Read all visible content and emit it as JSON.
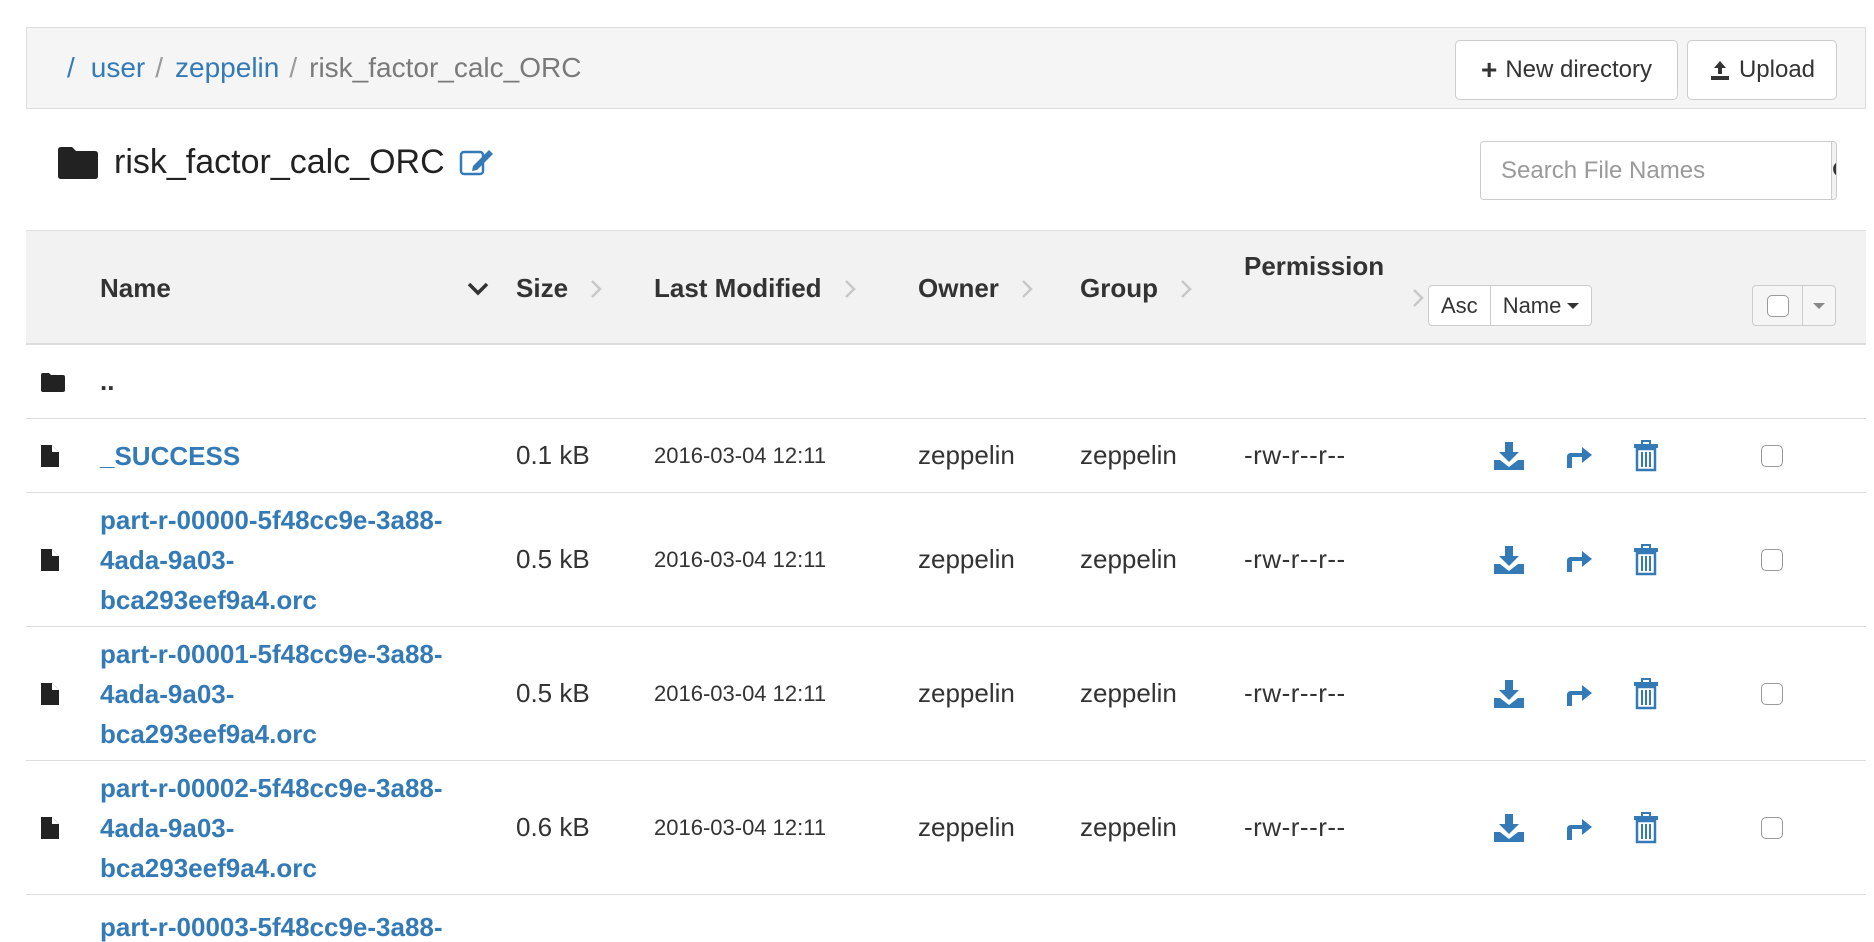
{
  "breadcrumb": {
    "root": "/",
    "separator": "/",
    "items": [
      "user",
      "zeppelin"
    ],
    "current": "risk_factor_calc_ORC"
  },
  "toolbar": {
    "new_directory_label": "New directory",
    "upload_label": "Upload"
  },
  "directory": {
    "title": "risk_factor_calc_ORC"
  },
  "search": {
    "placeholder": "Search File Names",
    "value": ""
  },
  "table": {
    "headers": {
      "name": "Name",
      "size": "Size",
      "last_modified": "Last Modified",
      "owner": "Owner",
      "group": "Group",
      "permission": "Permission"
    },
    "sort": {
      "order_label": "Asc",
      "field_label": "Name"
    },
    "parent_row": {
      "name": ".."
    },
    "rows": [
      {
        "name": "_SUCCESS",
        "name_lines": [
          "_SUCCESS"
        ],
        "size": "0.1 kB",
        "modified": "2016-03-04 12:11",
        "owner": "zeppelin",
        "group": "zeppelin",
        "permission": "-rw-r--r--",
        "checked": false
      },
      {
        "name": "part-r-00000-5f48cc9e-3a88-4ada-9a03-bca293eef9a4.orc",
        "name_lines": [
          "part-r-00000-5f48cc9e-3a88-",
          "4ada-9a03-",
          "bca293eef9a4.orc"
        ],
        "size": "0.5 kB",
        "modified": "2016-03-04 12:11",
        "owner": "zeppelin",
        "group": "zeppelin",
        "permission": "-rw-r--r--",
        "checked": false
      },
      {
        "name": "part-r-00001-5f48cc9e-3a88-4ada-9a03-bca293eef9a4.orc",
        "name_lines": [
          "part-r-00001-5f48cc9e-3a88-",
          "4ada-9a03-",
          "bca293eef9a4.orc"
        ],
        "size": "0.5 kB",
        "modified": "2016-03-04 12:11",
        "owner": "zeppelin",
        "group": "zeppelin",
        "permission": "-rw-r--r--",
        "checked": false
      },
      {
        "name": "part-r-00002-5f48cc9e-3a88-4ada-9a03-bca293eef9a4.orc",
        "name_lines": [
          "part-r-00002-5f48cc9e-3a88-",
          "4ada-9a03-",
          "bca293eef9a4.orc"
        ],
        "size": "0.6 kB",
        "modified": "2016-03-04 12:11",
        "owner": "zeppelin",
        "group": "zeppelin",
        "permission": "-rw-r--r--",
        "checked": false
      },
      {
        "name": "part-r-00003-5f48cc9e-3a88-",
        "name_lines": [
          "part-r-00003-5f48cc9e-3a88-"
        ]
      }
    ]
  },
  "icons": {
    "folder": "folder-icon",
    "file": "file-icon",
    "edit": "edit-icon",
    "search": "search-icon",
    "download": "download-icon",
    "move": "move-icon",
    "delete": "trash-icon",
    "sort_active": "chevron-down-icon",
    "sort_inactive": "chevron-right-icon"
  },
  "colors": {
    "link": "#337ab7",
    "header_bg": "#f2f2f2",
    "breadcrumb_bg": "#f5f5f5"
  }
}
